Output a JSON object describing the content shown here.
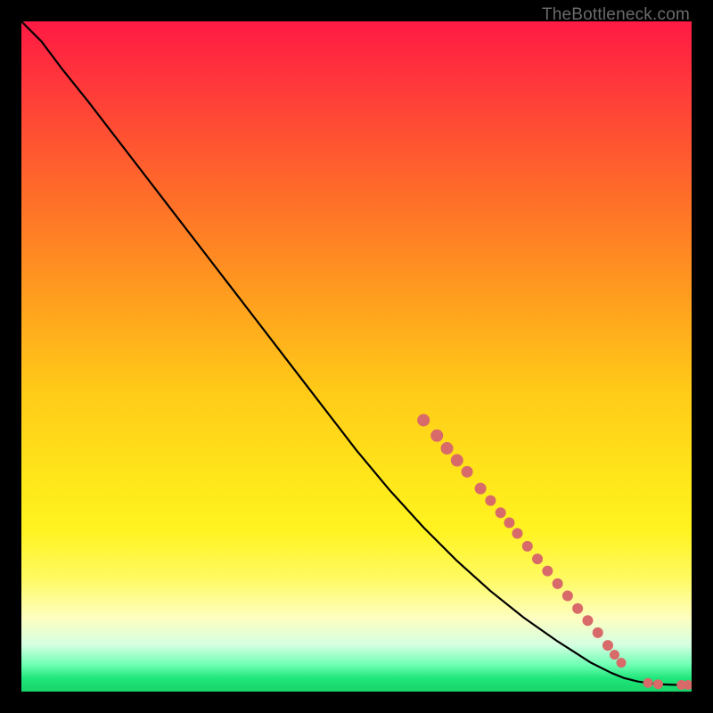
{
  "attribution": "TheBottleneck.com",
  "colors": {
    "frame": "#000000",
    "line": "#000000",
    "dot": "#d86a6a",
    "gradient_top": "#ff1a44",
    "gradient_bottom": "#17d468"
  },
  "chart_data": {
    "type": "line",
    "title": "",
    "xlabel": "",
    "ylabel": "",
    "xlim": [
      0,
      100
    ],
    "ylim": [
      0,
      100
    ],
    "grid": false,
    "legend": false,
    "series": [
      {
        "name": "curve",
        "x": [
          0,
          3,
          6,
          10,
          15,
          20,
          25,
          30,
          35,
          40,
          45,
          50,
          55,
          60,
          65,
          70,
          75,
          80,
          85,
          88,
          90,
          92,
          95,
          98,
          100
        ],
        "y": [
          100,
          97,
          93,
          88,
          81.5,
          75,
          68.5,
          62,
          55.5,
          49,
          42.5,
          36,
          30,
          24.5,
          19.5,
          15,
          11,
          7.5,
          4.3,
          2.8,
          2.0,
          1.5,
          1.1,
          1.0,
          1.0
        ]
      }
    ],
    "markers": [
      {
        "x": 60.0,
        "y": 40.5,
        "r": 6.5
      },
      {
        "x": 62.0,
        "y": 38.2,
        "r": 6.5
      },
      {
        "x": 63.5,
        "y": 36.3,
        "r": 6.5
      },
      {
        "x": 65.0,
        "y": 34.5,
        "r": 6.5
      },
      {
        "x": 66.5,
        "y": 32.8,
        "r": 6.0
      },
      {
        "x": 68.5,
        "y": 30.3,
        "r": 6.0
      },
      {
        "x": 70.0,
        "y": 28.5,
        "r": 5.5
      },
      {
        "x": 71.5,
        "y": 26.7,
        "r": 5.5
      },
      {
        "x": 72.8,
        "y": 25.2,
        "r": 5.5
      },
      {
        "x": 74.0,
        "y": 23.6,
        "r": 5.5
      },
      {
        "x": 75.5,
        "y": 21.7,
        "r": 5.5
      },
      {
        "x": 77.0,
        "y": 19.8,
        "r": 5.5
      },
      {
        "x": 78.5,
        "y": 18.0,
        "r": 5.5
      },
      {
        "x": 80.0,
        "y": 16.1,
        "r": 5.5
      },
      {
        "x": 81.5,
        "y": 14.3,
        "r": 5.5
      },
      {
        "x": 83.0,
        "y": 12.4,
        "r": 5.5
      },
      {
        "x": 84.5,
        "y": 10.6,
        "r": 5.5
      },
      {
        "x": 86.0,
        "y": 8.8,
        "r": 5.5
      },
      {
        "x": 87.5,
        "y": 6.9,
        "r": 5.5
      },
      {
        "x": 88.5,
        "y": 5.5,
        "r": 5.0
      },
      {
        "x": 89.5,
        "y": 4.3,
        "r": 5.0
      },
      {
        "x": 93.5,
        "y": 1.3,
        "r": 5.0
      },
      {
        "x": 95.0,
        "y": 1.1,
        "r": 5.0
      },
      {
        "x": 98.5,
        "y": 1.0,
        "r": 5.0
      },
      {
        "x": 99.5,
        "y": 1.0,
        "r": 5.0
      }
    ]
  }
}
